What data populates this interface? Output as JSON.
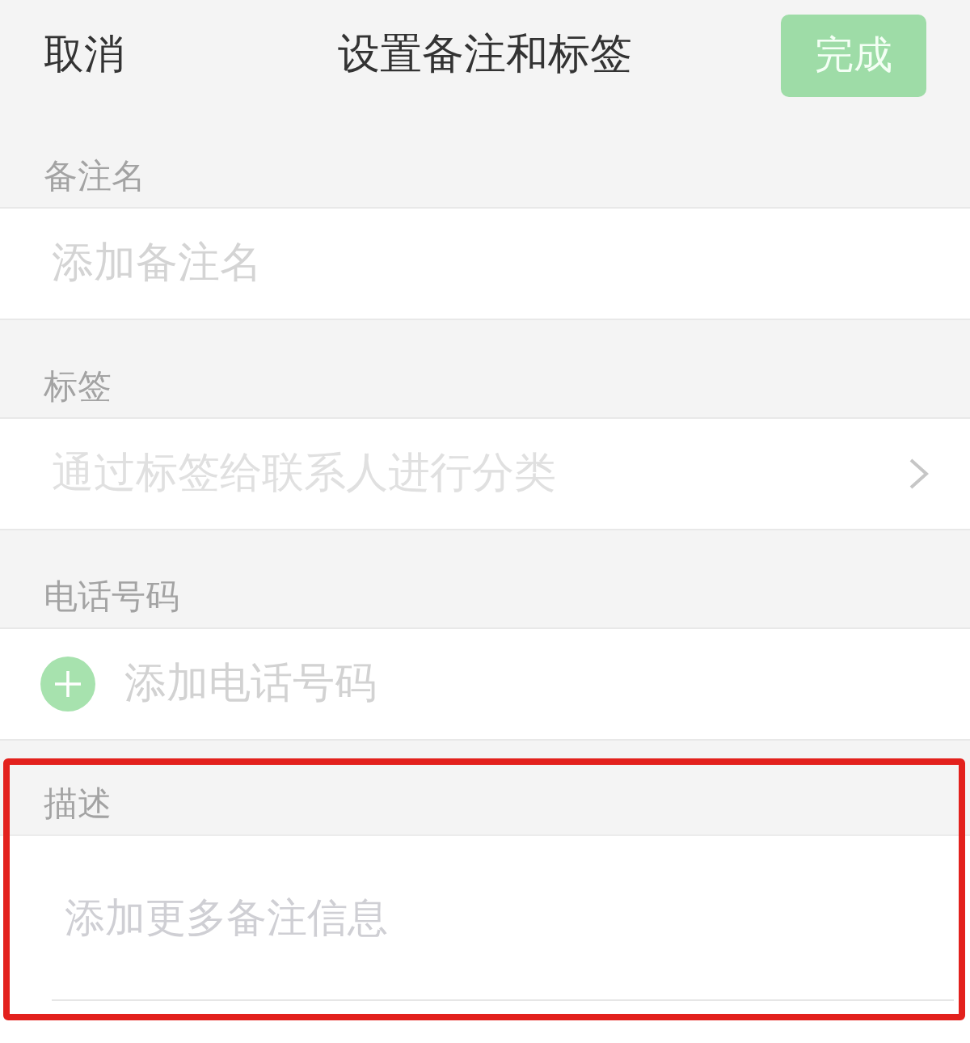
{
  "nav": {
    "cancel": "取消",
    "title": "设置备注和标签",
    "done": {
      "label": "完成",
      "disabled": true
    }
  },
  "sections": [
    {
      "kind": "text",
      "label": "备注名",
      "placeholder": "添加备注名"
    },
    {
      "kind": "link",
      "label": "标签",
      "text": "通过标签给联系人进行分类"
    },
    {
      "kind": "add",
      "label": "电话号码",
      "text": "添加电话号码"
    },
    {
      "kind": "textarea",
      "label": "描述",
      "placeholder": "添加更多备注信息",
      "highlighted": true
    }
  ]
}
